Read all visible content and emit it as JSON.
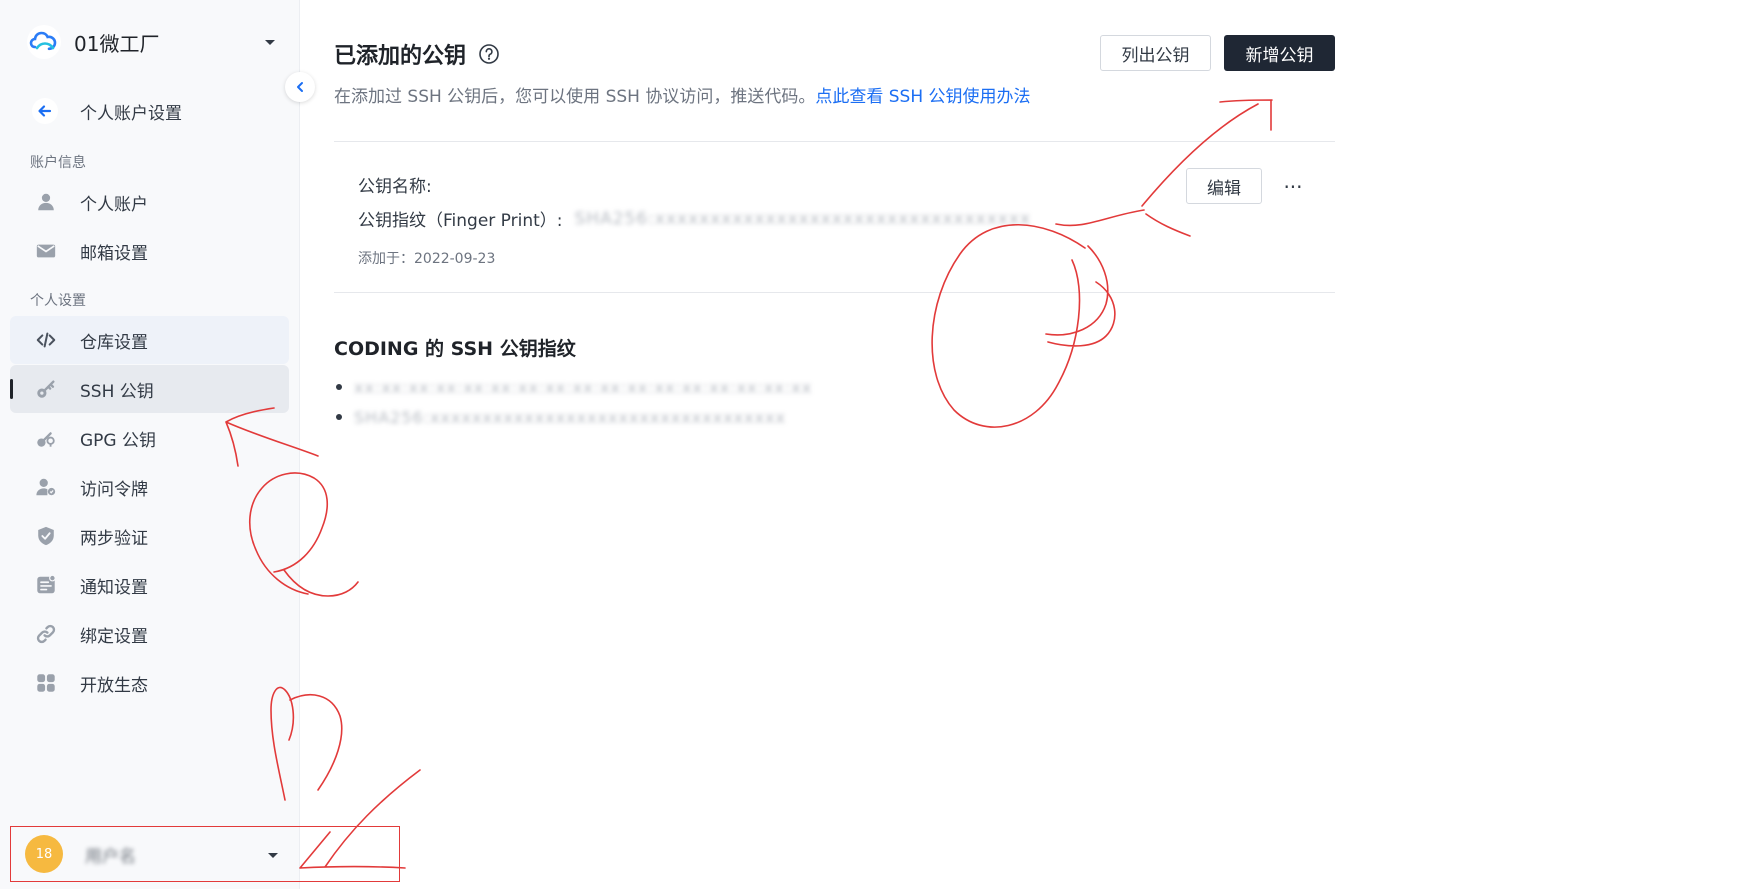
{
  "sidebar": {
    "brand_name": "01微工厂",
    "back_label": "个人账户设置",
    "sections": [
      {
        "title": "账户信息"
      },
      {
        "title": "个人设置"
      }
    ],
    "items": [
      {
        "label": "个人账户",
        "icon": "user-icon"
      },
      {
        "label": "邮箱设置",
        "icon": "mail-icon"
      },
      {
        "label": "仓库设置",
        "icon": "code-icon"
      },
      {
        "label": "SSH 公钥",
        "icon": "key-icon"
      },
      {
        "label": "GPG 公钥",
        "icon": "gpg-key-icon"
      },
      {
        "label": "访问令牌",
        "icon": "token-icon"
      },
      {
        "label": "两步验证",
        "icon": "shield-icon"
      },
      {
        "label": "通知设置",
        "icon": "notification-icon"
      },
      {
        "label": "绑定设置",
        "icon": "link-icon"
      },
      {
        "label": "开放生态",
        "icon": "apps-icon"
      }
    ],
    "active_item": "SSH 公钥",
    "user": {
      "avatar_text": "18",
      "name": "用户名"
    }
  },
  "main": {
    "title": "已添加的公钥",
    "subtitle": "在添加过 SSH 公钥后，您可以使用 SSH 协议访问，推送代码。",
    "subtitle_link": "点此查看 SSH 公钥使用办法",
    "list_button": "列出公钥",
    "add_button": "新增公钥",
    "key": {
      "name_label": "公钥名称:",
      "fingerprint_label": "公钥指纹（Finger Print）:",
      "fingerprint_value": "SHA256:xxxxxxxxxxxxxxxxxxxxxxxxxxxxxxxxxx",
      "date_text": "添加于：2022-09-23",
      "edit_button": "编辑",
      "more_label": "···"
    },
    "fingerprints_title": "CODING 的 SSH 公钥指纹",
    "fingerprints": [
      "xx:xx:xx:xx:xx:xx:xx:xx:xx:xx:xx:xx:xx:xx:xx:xx:xx",
      "SHA256:xxxxxxxxxxxxxxxxxxxxxxxxxxxxxxxxxx"
    ]
  },
  "colors": {
    "accent": "#1f2734",
    "link": "#1b6ef3",
    "annotation": "#e23a3a",
    "avatar": "#f6b940"
  }
}
